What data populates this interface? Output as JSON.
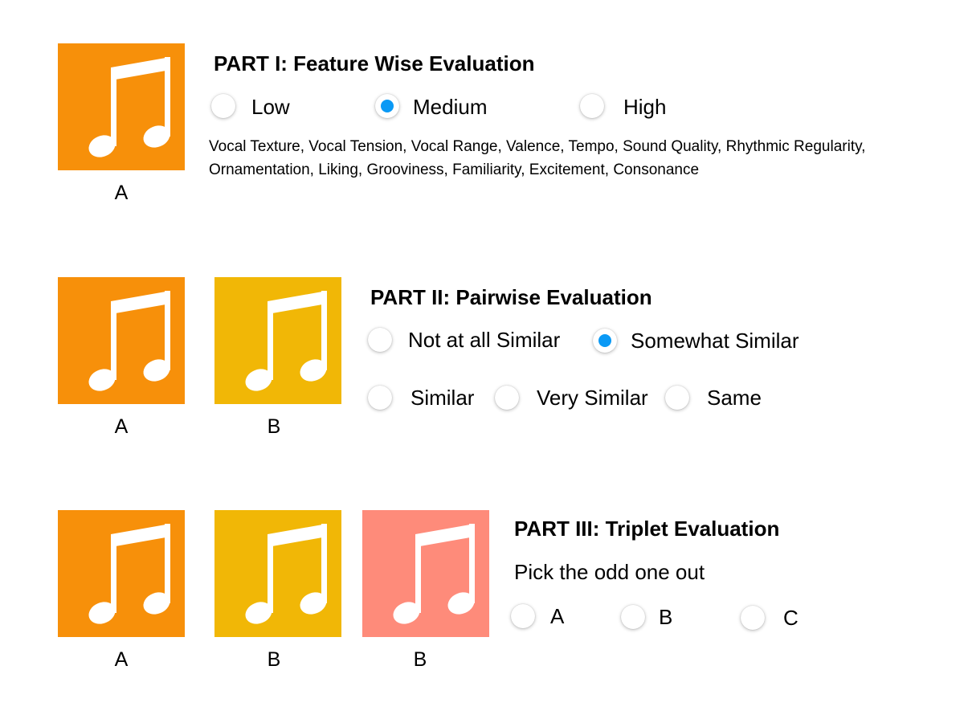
{
  "colors": {
    "tile_a": "#F7900A",
    "tile_b": "#F1B706",
    "tile_c": "#FE8B7A",
    "radio_selected": "#0A99F5",
    "note_glyph": "#FFFFFF"
  },
  "icons": {
    "tile_icon": "music-note-icon"
  },
  "part1": {
    "heading": "PART I: Feature Wise Evaluation",
    "tiles": [
      {
        "label": "A",
        "color": "#F7900A"
      }
    ],
    "options": [
      {
        "label": "Low",
        "selected": false
      },
      {
        "label": "Medium",
        "selected": true
      },
      {
        "label": "High",
        "selected": false
      }
    ],
    "attributes": "Vocal Texture, Vocal Tension, Vocal Range, Valence, Tempo, Sound Quality, Rhythmic Regularity, Ornamentation, Liking, Grooviness, Familiarity, Excitement, Consonance"
  },
  "part2": {
    "heading": "PART II: Pairwise Evaluation",
    "tiles": [
      {
        "label": "A",
        "color": "#F7900A"
      },
      {
        "label": "B",
        "color": "#F1B706"
      }
    ],
    "options": [
      {
        "label": "Not at all Similar",
        "selected": false
      },
      {
        "label": "Somewhat Similar",
        "selected": true
      },
      {
        "label": "Similar",
        "selected": false
      },
      {
        "label": "Very Similar",
        "selected": false
      },
      {
        "label": "Same",
        "selected": false
      }
    ]
  },
  "part3": {
    "heading": "PART III: Triplet Evaluation",
    "instruction": "Pick the odd one out",
    "tiles": [
      {
        "label": "A",
        "color": "#F7900A"
      },
      {
        "label": "B",
        "color": "#F1B706"
      },
      {
        "label": "B",
        "color": "#FE8B7A"
      }
    ],
    "options": [
      {
        "label": "A",
        "selected": false
      },
      {
        "label": "B",
        "selected": false
      },
      {
        "label": "C",
        "selected": false
      }
    ]
  }
}
